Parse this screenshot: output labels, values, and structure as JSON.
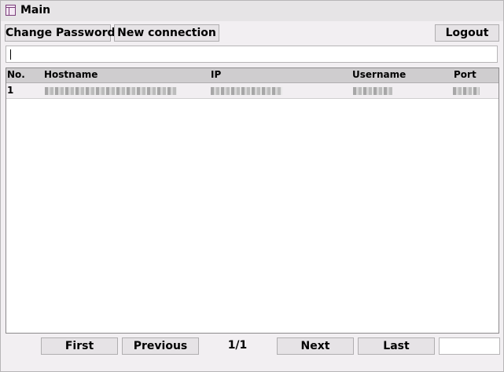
{
  "window": {
    "title": "Main"
  },
  "toolbar": {
    "change_password": "Change Password",
    "new_connection": "New connection",
    "logout": "Logout"
  },
  "search": {
    "value": ""
  },
  "table": {
    "columns": [
      "No.",
      "Hostname",
      "IP",
      "Username",
      "Port"
    ],
    "rows": [
      {
        "no": "1"
      }
    ]
  },
  "pagination": {
    "first": "First",
    "previous": "Previous",
    "indicator": "1/1",
    "next": "Next",
    "last": "Last",
    "page_value": ""
  }
}
